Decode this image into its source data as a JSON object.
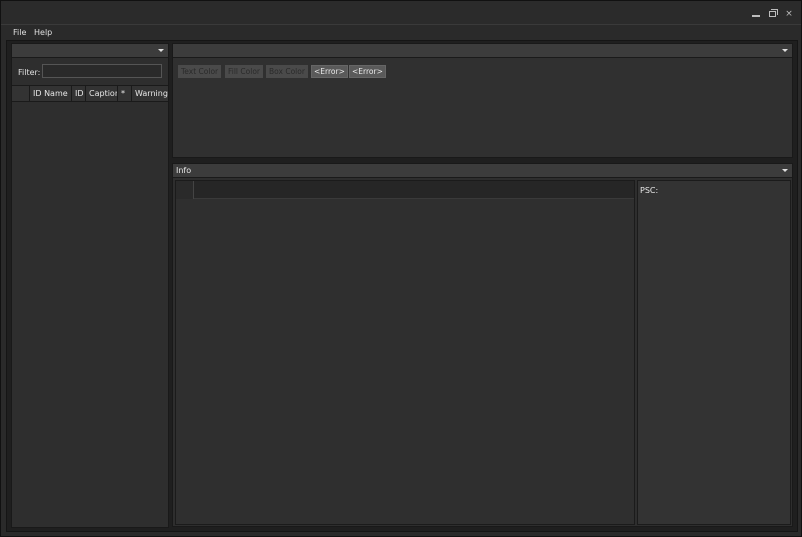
{
  "window": {
    "title": "",
    "controls": {
      "minimize_icon": "minimize-icon",
      "maximize_icon": "restore-icon",
      "close_glyph": "×"
    }
  },
  "menu": {
    "file": "File",
    "help": "Help"
  },
  "left_panel": {
    "dropdown_value": "",
    "filter_label": "Filter:",
    "filter_value": "",
    "columns": [
      "ID Name",
      "ID",
      "Caption",
      "*",
      "Warning"
    ]
  },
  "top_right_panel": {
    "dropdown_value": "",
    "buttons": {
      "text_color": "Text Color",
      "fill_color": "Fill Color",
      "box_color": "Box Color",
      "error_1": "<Error>",
      "error_2": "<Error>"
    }
  },
  "info_panel": {
    "title": "Info",
    "psc_label": "PSC:"
  },
  "colors": {
    "window_bg": "#2a2a2a",
    "panel_header": "#3c3c3c",
    "text": "#e0e0e0"
  }
}
